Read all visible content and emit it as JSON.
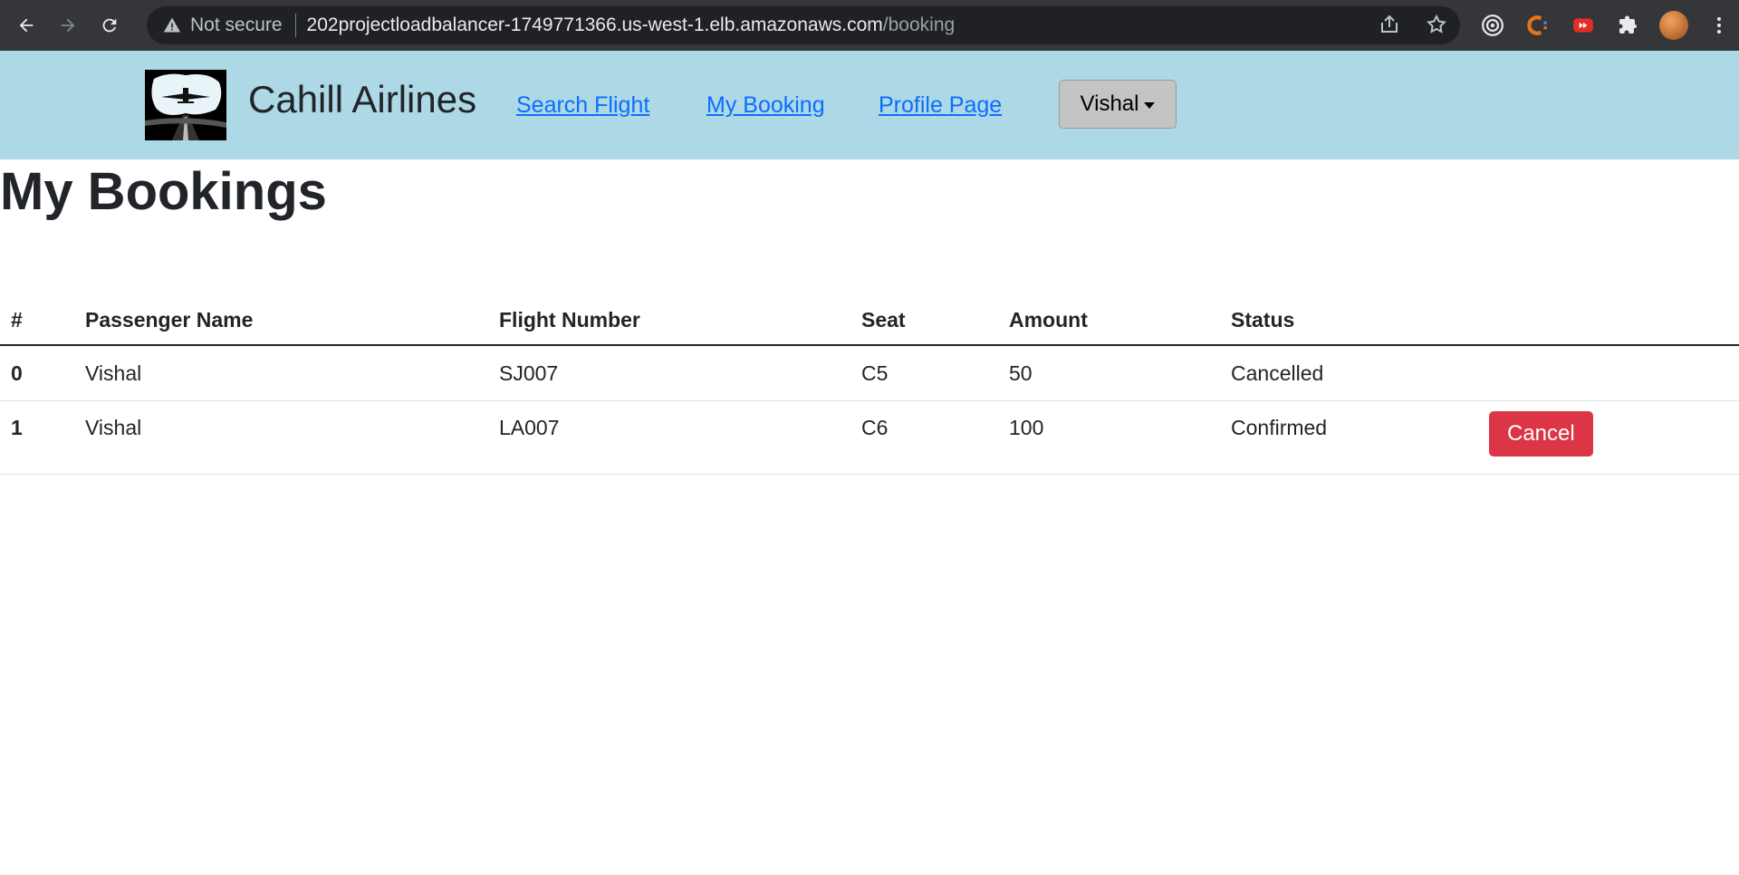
{
  "browser": {
    "security_label": "Not secure",
    "url_host": "202projectloadbalancer-1749771366.us-west-1.elb.amazonaws.com",
    "url_path": "/booking"
  },
  "header": {
    "brand": "Cahill Airlines",
    "nav": {
      "search_flight": "Search Flight",
      "my_booking": "My Booking",
      "profile_page": "Profile Page"
    },
    "user_menu": "Vishal"
  },
  "main": {
    "title": "My Bookings",
    "table": {
      "headers": [
        "#",
        "Passenger Name",
        "Flight Number",
        "Seat",
        "Amount",
        "Status",
        ""
      ],
      "rows": [
        {
          "index": "0",
          "passenger": "Vishal",
          "flight": "SJ007",
          "seat": "C5",
          "amount": "50",
          "status": "Cancelled",
          "action": ""
        },
        {
          "index": "1",
          "passenger": "Vishal",
          "flight": "LA007",
          "seat": "C6",
          "amount": "100",
          "status": "Confirmed",
          "action": "Cancel"
        }
      ]
    }
  },
  "colors": {
    "header_bg": "#add8e6",
    "link": "#0d6efd",
    "danger": "#dc3545"
  }
}
